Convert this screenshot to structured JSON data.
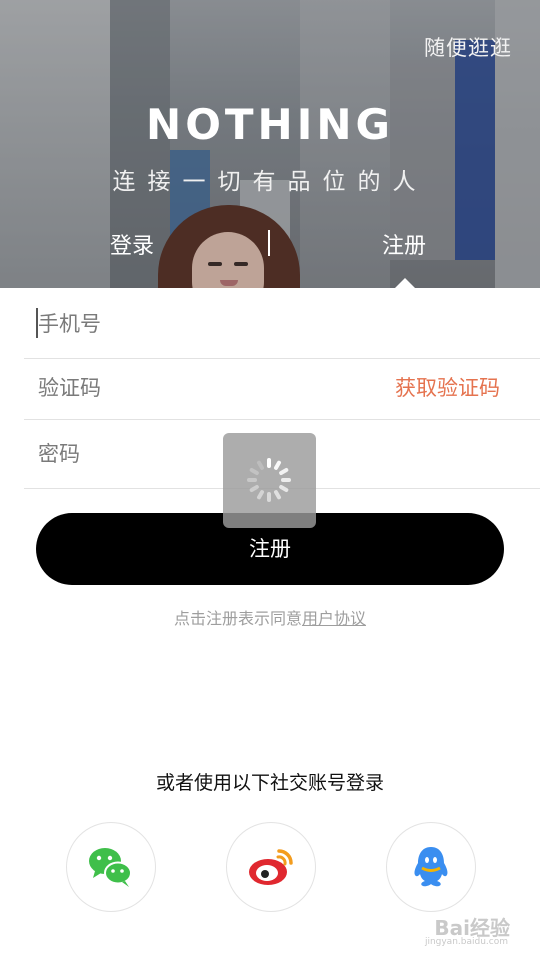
{
  "header": {
    "browse_link": "随便逛逛",
    "brand": "NOTHING",
    "tagline": "连接一切有品位的人",
    "tabs": {
      "login": "登录",
      "register": "注册"
    }
  },
  "form": {
    "phone_placeholder": "手机号",
    "code_placeholder": "验证码",
    "get_code": "获取验证码",
    "password_placeholder": "密码",
    "submit": "注册",
    "agreement_prefix": "点击注册表示同意",
    "agreement_link": "用户协议"
  },
  "social": {
    "title": "或者使用以下社交账号登录",
    "providers": [
      "wechat",
      "weibo",
      "qq"
    ],
    "icons": [
      "wechat-icon",
      "weibo-icon",
      "qq-icon"
    ]
  },
  "watermark": {
    "text": "Bai经验",
    "sub": "jingyan.baidu.com"
  },
  "colors": {
    "accent": "#e5734f",
    "button": "#000000",
    "wechat": "#3fbf4a",
    "weibo": "#e0282f",
    "qq": "#3a8ef0"
  }
}
